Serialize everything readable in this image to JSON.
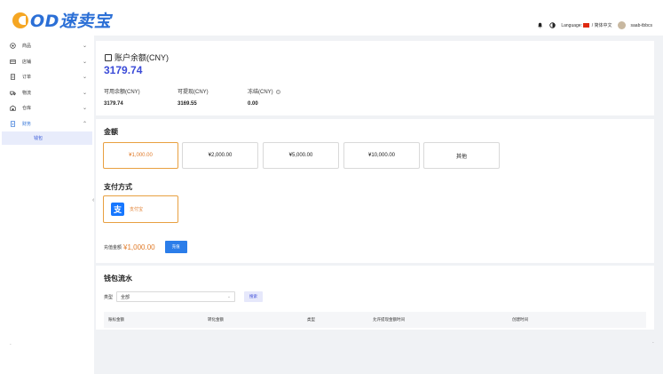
{
  "header": {
    "logo_text": "OD速卖宝",
    "language_label": "Language:",
    "language_value": "/ 简体中文",
    "username": "saab-tbbcs"
  },
  "sidebar": {
    "items": [
      {
        "label": "商品",
        "icon": "product-icon"
      },
      {
        "label": "店铺",
        "icon": "store-icon"
      },
      {
        "label": "订单",
        "icon": "order-icon"
      },
      {
        "label": "物流",
        "icon": "truck-icon"
      },
      {
        "label": "仓库",
        "icon": "warehouse-icon"
      },
      {
        "label": "财务",
        "icon": "finance-icon"
      }
    ],
    "submenu": {
      "label": "钱包"
    }
  },
  "balance": {
    "title": "账户余额(CNY)",
    "amount": "3179.74",
    "stats": [
      {
        "label": "可用余额(CNY)",
        "value": "3179.74"
      },
      {
        "label": "可提现(CNY)",
        "value": "3169.55"
      },
      {
        "label": "冻结(CNY)",
        "value": "0.00"
      }
    ]
  },
  "amount_section": {
    "title": "金额",
    "options": [
      "¥1,000.00",
      "¥2,000.00",
      "¥5,000.00",
      "¥10,000.00",
      "其他"
    ],
    "selected_index": 0
  },
  "payment": {
    "title": "支付方式",
    "method_label": "支付宝",
    "icon_glyph": "支"
  },
  "charge": {
    "label": "充值金额",
    "amount": "¥1,000.00",
    "button": "充值"
  },
  "flow": {
    "title": "钱包流水",
    "type_label": "类型",
    "type_value": "全部",
    "search_button": "搜索",
    "columns": [
      "账标金额",
      "转化金额",
      "类型",
      "允许提现金额时间",
      "创建时间"
    ]
  },
  "colors": {
    "accent": "#3b4bd8",
    "orange": "#e07b2a",
    "primary_button": "#2b7de9"
  }
}
